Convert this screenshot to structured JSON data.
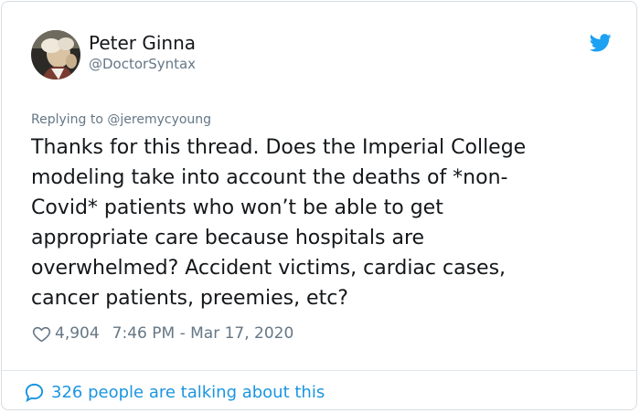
{
  "author": {
    "name": "Peter Ginna",
    "handle": "@DoctorSyntax"
  },
  "reply_to": "Replying to @jeremycyoung",
  "tweet_lines": [
    "Thanks for this thread. Does the Imperial College",
    "modeling take into account the deaths of *non-",
    "Covid* patients who won’t be able to get",
    "appropriate care because hospitals are",
    "overwhelmed? Accident victims, cardiac cases,",
    "cancer patients, preemies, etc?"
  ],
  "likes": "4,904",
  "timestamp": "7:46 PM - Mar 17, 2020",
  "footer": "326 people are talking about this",
  "icons": {
    "logo": "twitter-bird-icon",
    "like": "heart-icon",
    "talk": "speech-bubble-icon"
  },
  "colors": {
    "accent": "#1da1f2",
    "link": "#1b95e0",
    "text": "#14171a",
    "muted": "#657786"
  }
}
